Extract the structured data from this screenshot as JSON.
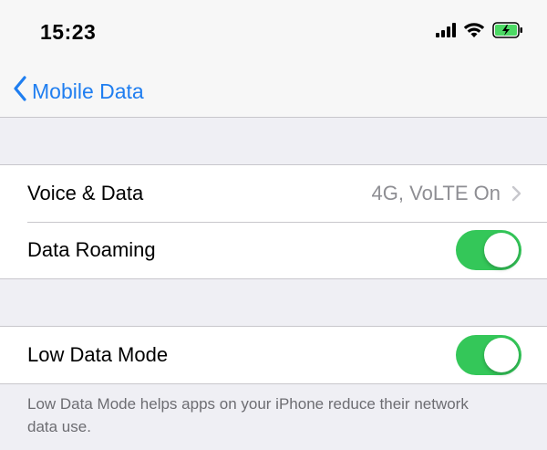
{
  "status_bar": {
    "time": "15:23",
    "icons": [
      "cellular-signal-icon",
      "wifi-icon",
      "battery-charging-icon"
    ],
    "battery_color": "#4cd964"
  },
  "nav": {
    "back_label": "Mobile Data",
    "accent_color": "#1f7ef0"
  },
  "groups": [
    {
      "rows": [
        {
          "label": "Voice & Data",
          "value": "4G, VoLTE On",
          "accessory": "chevron-right-icon"
        },
        {
          "label": "Data Roaming",
          "toggle_on": true
        }
      ]
    },
    {
      "rows": [
        {
          "label": "Low Data Mode",
          "toggle_on": true
        }
      ],
      "footer": "Low Data Mode helps apps on your iPhone reduce their network data use."
    }
  ],
  "toggle_on_color": "#34c759"
}
